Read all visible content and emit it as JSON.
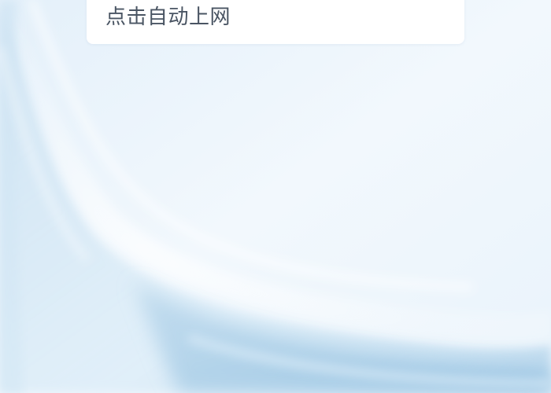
{
  "card": {
    "text": "点击自动上网"
  },
  "colors": {
    "background": "#eef6fd",
    "silk_light": "#d7eaf6",
    "silk_mid": "#c3ddef",
    "silk_deep": "#9ec6e2",
    "card_background": "#ffffff",
    "text": "#4a5563"
  },
  "background": {
    "icon": "silk-wave-wallpaper"
  }
}
